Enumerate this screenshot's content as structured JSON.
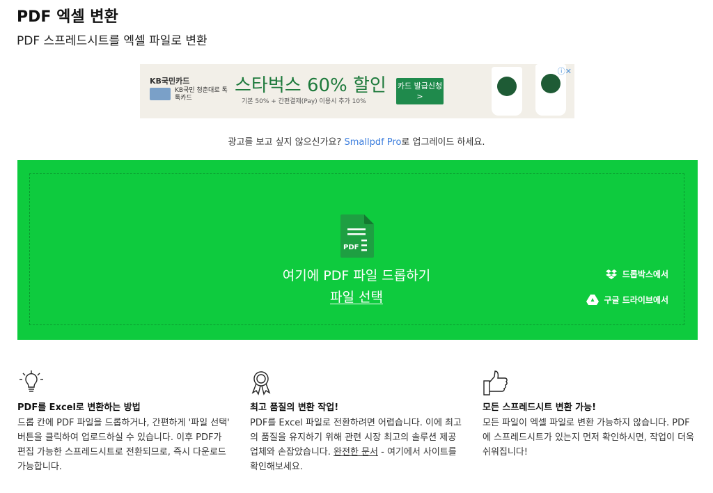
{
  "header": {
    "title": "PDF 엑셀 변환",
    "subtitle": "PDF 스프레드시트를 엑셀 파일로 변환"
  },
  "ad": {
    "brand": "KB국민카드",
    "card_text": "KB국민 청춘대로 톡톡카드",
    "headline": "스타벅스 60% 할인",
    "small_text": "기본 50% + 간편결제(Pay) 이용시 추가 10%",
    "cta": "카드 발급신청 >",
    "adchoices": "ⓘ✕"
  },
  "upgrade": {
    "before": "광고를 보고 싶지 않으신가요? ",
    "link": "Smallpdf Pro",
    "after": "로 업그레이드 하세요."
  },
  "dropzone": {
    "icon_label": "PDF",
    "drop_text": "여기에 PDF 파일 드롭하기",
    "choose_file": "파일 선택",
    "dropbox": "드롭박스에서",
    "gdrive": "구글 드라이브에서",
    "bg_color": "#0ecb3e"
  },
  "features": [
    {
      "icon": "lightbulb-icon",
      "title": "PDF를 Excel로 변환하는 방법",
      "body": "드롭 칸에 PDF 파일을 드롭하거나, 간편하게 '파일 선택' 버튼을 클릭하여 업로드하실 수 있습니다. 이후 PDF가 편집 가능한 스프레드시트로 전환되므로, 즉시 다운로드 가능합니다."
    },
    {
      "icon": "award-ribbon-icon",
      "title": "최고 품질의 변환 작업!",
      "body_before": "PDF를 Excel 파일로 전환하려면 어렵습니다. 이에 최고의 품질을 유지하기 위해 관련 시장 최고의 솔루션 제공업체와 손잡았습니다. ",
      "link": "완전한 문서",
      "body_after": " - 여기에서 사이트를 확인해보세요."
    },
    {
      "icon": "thumbs-up-icon",
      "title": "모든 스프레드시트 변환 가능!",
      "body": "모든 파일이 엑셀 파일로 변환 가능하지 않습니다. PDF에 스프레드시트가 있는지 먼저 확인하시면, 작업이 더욱 쉬워집니다!"
    }
  ]
}
